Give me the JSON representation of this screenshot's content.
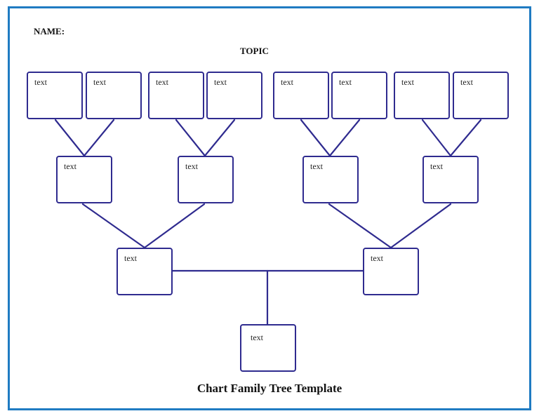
{
  "header": {
    "name_label": "NAME:",
    "topic_label": "TOPIC"
  },
  "footer": {
    "title": "Chart Family Tree Template"
  },
  "colors": {
    "frame_border": "#1f7bc2",
    "box_stroke": "#2f2b8f",
    "connector": "#2f2b8f"
  },
  "tree": {
    "generation_4": [
      {
        "label": "text"
      },
      {
        "label": "text"
      },
      {
        "label": "text"
      },
      {
        "label": "text"
      },
      {
        "label": "text"
      },
      {
        "label": "text"
      },
      {
        "label": "text"
      },
      {
        "label": "text"
      }
    ],
    "generation_3": [
      {
        "label": "text"
      },
      {
        "label": "text"
      },
      {
        "label": "text"
      },
      {
        "label": "text"
      }
    ],
    "generation_2": [
      {
        "label": "text"
      },
      {
        "label": "text"
      }
    ],
    "generation_1": [
      {
        "label": "text"
      }
    ]
  }
}
